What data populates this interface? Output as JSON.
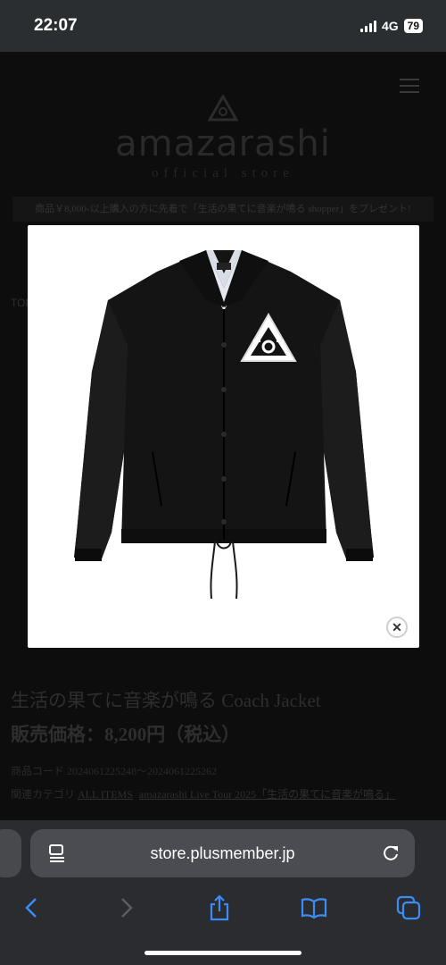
{
  "status_bar": {
    "time": "22:07",
    "network": "4G",
    "battery": "79"
  },
  "site": {
    "logo_text": "amazarashi",
    "logo_sub": "official store",
    "promo": "商品￥8,000-以上購入の方に先着で「生活の果てに音楽が鳴る shopper」をプレゼント!",
    "breadcrumb": "TOP"
  },
  "product": {
    "title": "生活の果てに音楽が鳴る Coach Jacket",
    "price": "販売価格：8,200円（税込）",
    "code": "商品コード 2024061225248～2024061225262",
    "category_label": "関連カテゴリ",
    "categories": [
      "ALL ITEMS",
      "amazarashi Live Tour 2025「生活の果てに音楽が鳴る」"
    ]
  },
  "modal": {
    "image_alt": "black coach jacket",
    "close_icon": "close-icon"
  },
  "browser": {
    "url": "store.plusmember.jp",
    "accent": "#3b8cf5"
  }
}
